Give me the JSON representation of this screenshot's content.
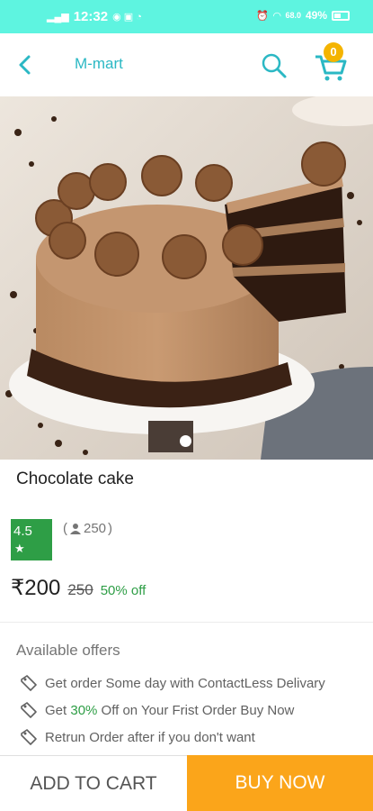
{
  "status_bar": {
    "time": "12:32",
    "network_speed": "68.0",
    "battery": "49%"
  },
  "app_bar": {
    "title": "M-mart",
    "cart_count": "0",
    "icons": {
      "back": "back-arrow-icon",
      "search": "search-icon",
      "cart": "cart-icon"
    }
  },
  "product": {
    "image": "chocolate-cake-photo",
    "carousel_index": 1,
    "title": "Chocolate cake",
    "rating": "4.5",
    "rating_star": "★",
    "reviews_count": "250",
    "price": "₹200",
    "mrp": "250",
    "discount": "50% off"
  },
  "offers": {
    "title": "Available offers",
    "items": [
      {
        "text": "Get order Some day with ContactLess Delivary"
      },
      {
        "before": "Get ",
        "highlight": "30%",
        "after": " Off on Your Frist Order Buy Now"
      },
      {
        "text": "Retrun Order after if you don't want"
      }
    ]
  },
  "actions": {
    "add_to_cart": "ADD TO CART",
    "buy_now": "BUY NOW"
  },
  "colors": {
    "accent": "#2bb8c4",
    "status_bar": "#5ef4e0",
    "rating_green": "#2e9e46",
    "buy_now": "#fba51a",
    "badge": "#f4b400"
  }
}
